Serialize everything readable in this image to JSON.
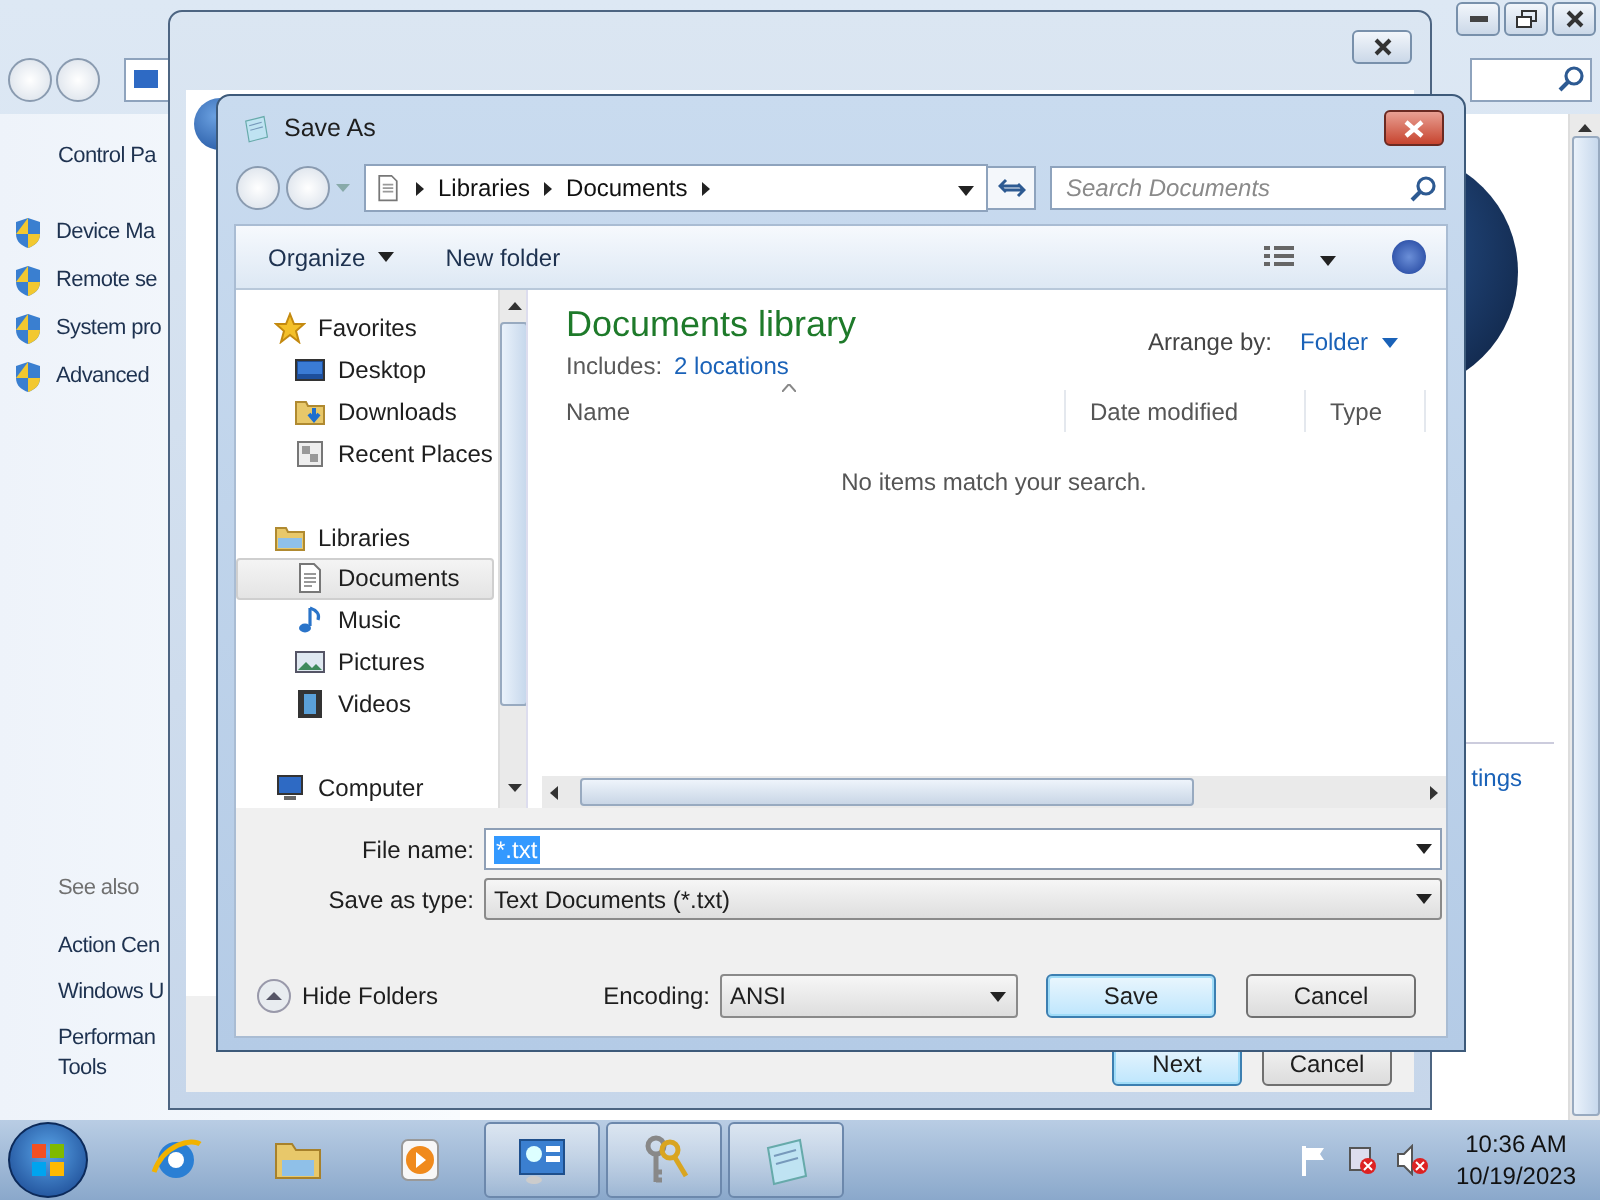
{
  "control_panel": {
    "breadcrumb": "Control Pa",
    "tasks": [
      "Device Ma",
      "Remote se",
      "System pro",
      "Advanced"
    ],
    "see_also_heading": "See also",
    "see_also": [
      "Action Cen",
      "Windows U",
      "Performan\nTools"
    ],
    "link": "tings"
  },
  "activation_wizard": {
    "buttons": [
      {
        "label": "Next",
        "default": true
      },
      {
        "label": "Cancel",
        "default": false
      }
    ]
  },
  "save_dialog": {
    "title": "Save As",
    "path": [
      "Libraries",
      "Documents"
    ],
    "search_placeholder": "Search Documents",
    "toolbar": {
      "organize": "Organize",
      "new_folder": "New folder"
    },
    "nav": [
      {
        "label": "Favorites",
        "kind": "favorites",
        "selected": false,
        "children": [
          {
            "label": "Desktop",
            "kind": "desktop",
            "selected": false
          },
          {
            "label": "Downloads",
            "kind": "downloads",
            "selected": false
          },
          {
            "label": "Recent Places",
            "kind": "recent",
            "selected": false
          }
        ]
      },
      {
        "label": "Libraries",
        "kind": "libraries",
        "selected": false,
        "children": [
          {
            "label": "Documents",
            "kind": "documents",
            "selected": true
          },
          {
            "label": "Music",
            "kind": "music",
            "selected": false
          },
          {
            "label": "Pictures",
            "kind": "pictures",
            "selected": false
          },
          {
            "label": "Videos",
            "kind": "videos",
            "selected": false
          }
        ]
      },
      {
        "label": "Computer",
        "kind": "computer",
        "selected": false
      }
    ],
    "library": {
      "title": "Documents library",
      "includes_label": "Includes:",
      "includes_link": "2 locations",
      "arrange_label": "Arrange by:",
      "arrange_value": "Folder"
    },
    "columns": [
      "Name",
      "Date modified",
      "Type"
    ],
    "empty_message": "No items match your search.",
    "file_name": {
      "label": "File name:",
      "value": "*.txt",
      "text_selected": true
    },
    "save_type": {
      "label": "Save as type:",
      "value": "Text Documents (*.txt)"
    },
    "hide_folders": "Hide Folders",
    "encoding": {
      "label": "Encoding:",
      "value": "ANSI"
    },
    "buttons": [
      {
        "label": "Save",
        "default": true
      },
      {
        "label": "Cancel",
        "default": false
      }
    ]
  },
  "taskbar": {
    "apps": [
      {
        "kind": "browser",
        "running": false
      },
      {
        "kind": "explorer",
        "running": false
      },
      {
        "kind": "media",
        "running": false
      },
      {
        "kind": "control_panel",
        "running": true
      },
      {
        "kind": "keys",
        "running": true
      },
      {
        "kind": "notepad",
        "running": true
      }
    ],
    "time": "10:36 AM",
    "date": "10/19/2023"
  }
}
